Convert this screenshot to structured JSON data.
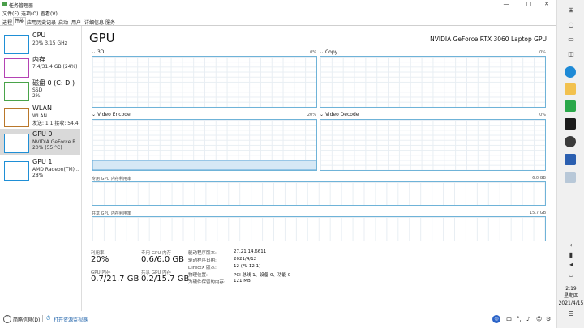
{
  "window": {
    "title": "任务管理器",
    "minimize": "—",
    "maximize": "▢",
    "close": "✕"
  },
  "menu": [
    "文件(F)",
    "选项(O)",
    "查看(V)"
  ],
  "tabs": [
    "进程",
    "性能",
    "应用历史记录",
    "启动",
    "用户",
    "详细信息",
    "服务"
  ],
  "sidebar": [
    {
      "name": "CPU",
      "line1": "20% 3.15 GHz",
      "line2": "",
      "color": "#1f8fd6"
    },
    {
      "name": "内存",
      "line1": "7.4/31.4 GB (24%)",
      "line2": "",
      "color": "#b443b4"
    },
    {
      "name": "磁盘 0 (C: D:)",
      "line1": "SSD",
      "line2": "2%",
      "color": "#4aa34a"
    },
    {
      "name": "WLAN",
      "line1": "WLAN",
      "line2": "发送: 1.1 接收: 54.4 M",
      "color": "#b9772a"
    },
    {
      "name": "GPU 0",
      "line1": "NVIDIA GeForce R...",
      "line2": "20% (55 °C)",
      "color": "#1f8fd6"
    },
    {
      "name": "GPU 1",
      "line1": "AMD Radeon(TM) ...",
      "line2": "28%",
      "color": "#1f8fd6"
    }
  ],
  "main": {
    "title": "GPU",
    "gpu_name": "NVIDIA GeForce RTX 3060 Laptop GPU",
    "engines": [
      {
        "label": "3D",
        "pct": "0%",
        "fill": 0
      },
      {
        "label": "Copy",
        "pct": "0%",
        "fill": 0
      },
      {
        "label": "Video Encode",
        "pct": "20%",
        "fill": 0.2
      },
      {
        "label": "Video Decode",
        "pct": "0%",
        "fill": 0
      }
    ],
    "dedicated_label": "专用 GPU 内存利用率",
    "dedicated_max": "6.0 GB",
    "shared_label": "共享 GPU 内存利用率",
    "shared_max": "15.7 GB",
    "stats": [
      {
        "label": "利用率",
        "value": "20%"
      },
      {
        "label": "专用 GPU 内存",
        "value": "0.6/6.0 GB"
      },
      {
        "label": "GPU 内存",
        "value": "0.7/21.7 GB"
      },
      {
        "label": "共享 GPU 内存",
        "value": "0.2/15.7 GB"
      }
    ],
    "info": [
      {
        "label": "驱动程序版本:",
        "value": "27.21.14.6611"
      },
      {
        "label": "驱动程序日期:",
        "value": "2021/4/12"
      },
      {
        "label": "DirectX 版本:",
        "value": "12 (FL 12.1)"
      },
      {
        "label": "物理位置:",
        "value": "PCI 总线 1、设备 0、功能 0"
      },
      {
        "label": "为硬件保留的内存:",
        "value": "121 MB"
      }
    ]
  },
  "footer": {
    "brief": "简略信息(D)",
    "resmon": "打开资源监视器"
  },
  "taskbar": {
    "time": "2:19",
    "weekday": "星期四",
    "date": "2021/4/15",
    "ime": "中"
  }
}
